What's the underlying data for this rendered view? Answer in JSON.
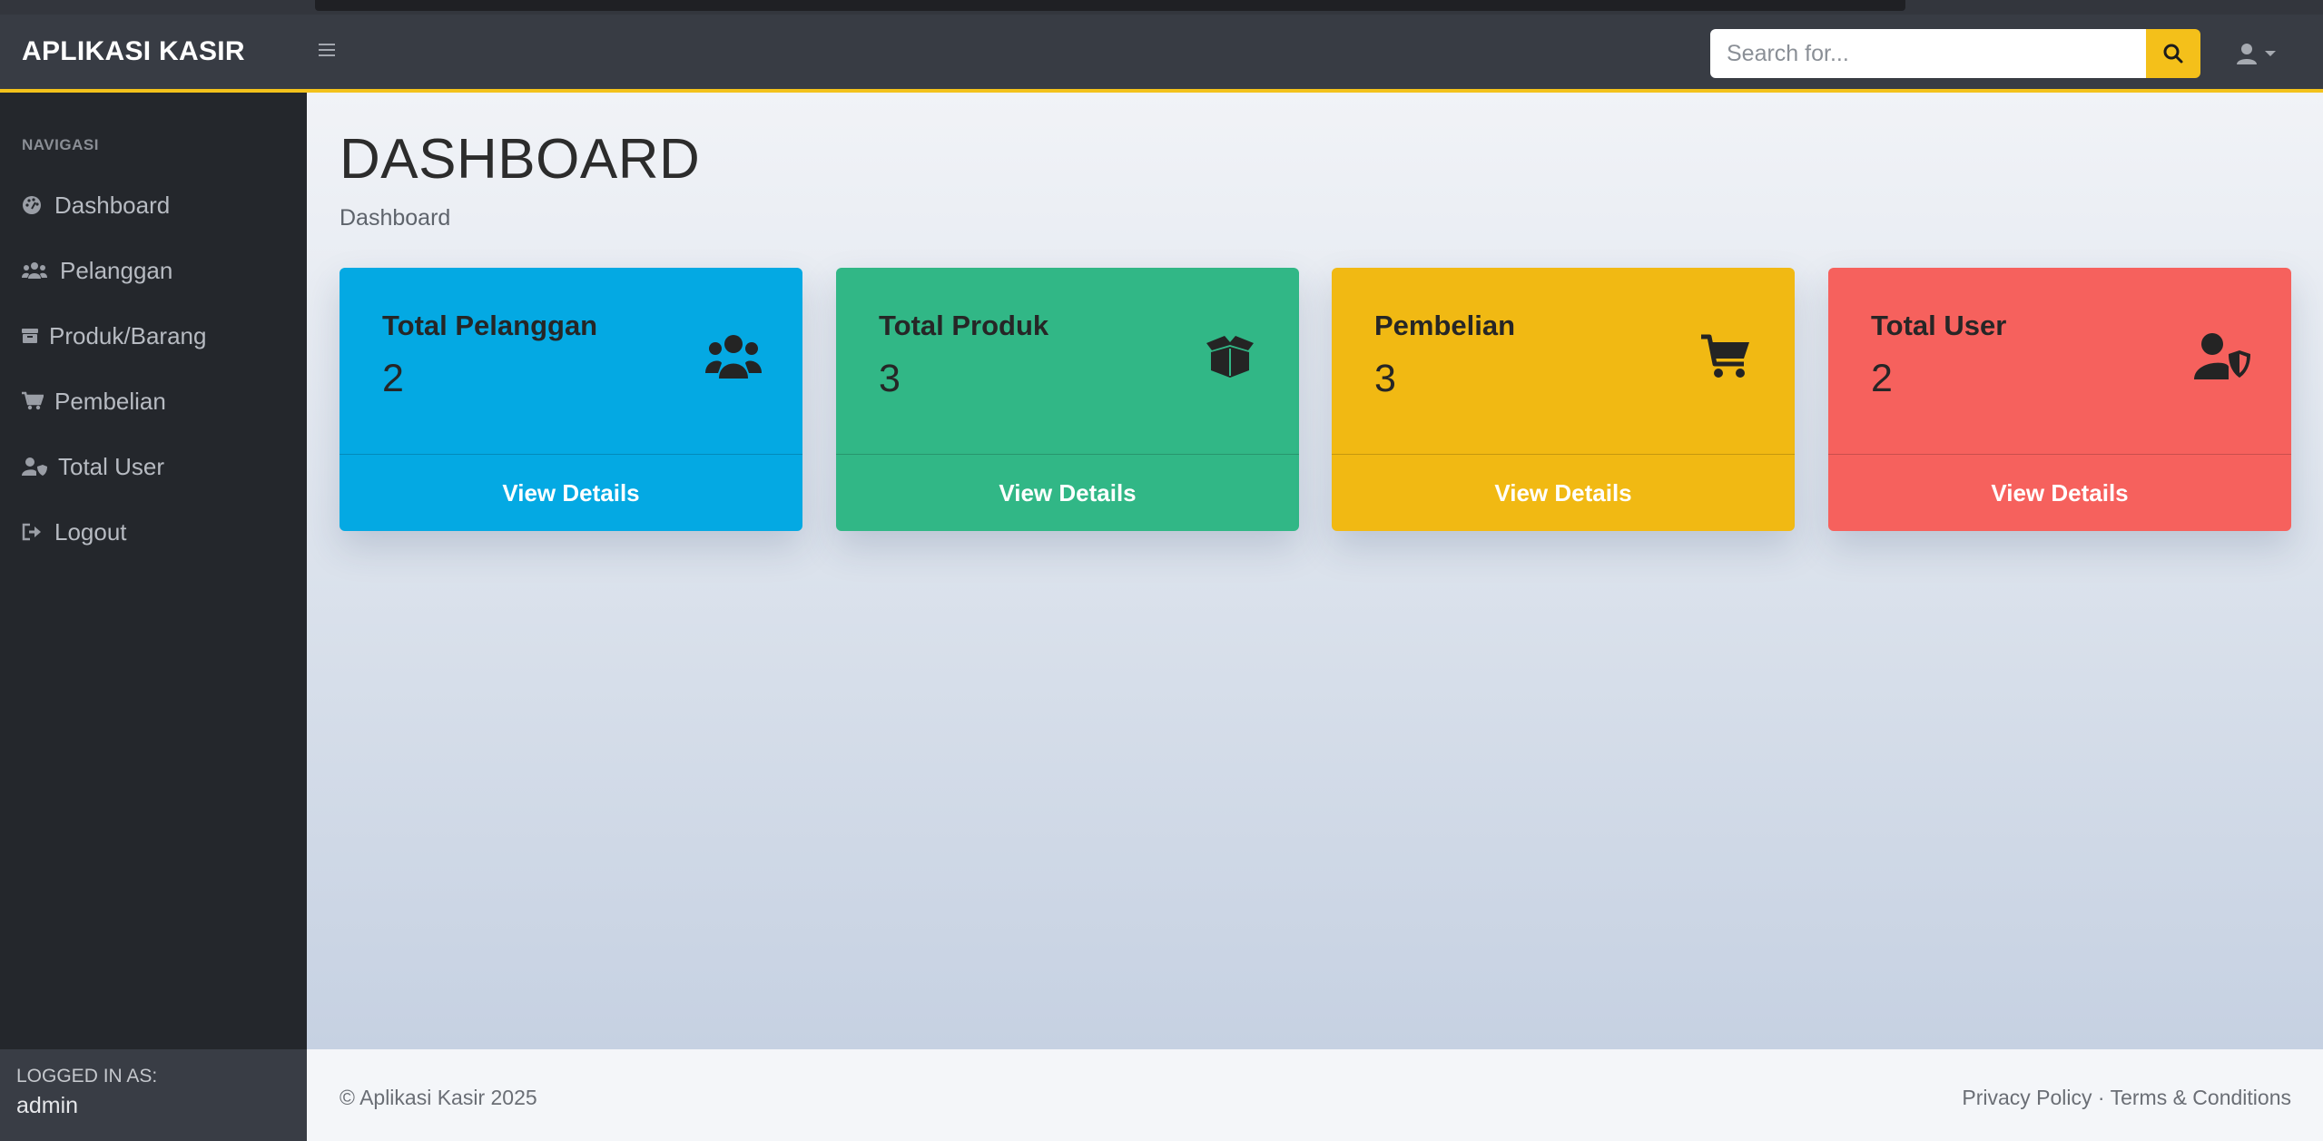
{
  "app": {
    "brand": "APLIKASI KASIR"
  },
  "search": {
    "placeholder": "Search for..."
  },
  "sidebar": {
    "heading": "NAVIGASI",
    "items": [
      {
        "label": "Dashboard",
        "icon": "dashboard-icon"
      },
      {
        "label": "Pelanggan",
        "icon": "users-icon"
      },
      {
        "label": "Produk/Barang",
        "icon": "box-icon"
      },
      {
        "label": "Pembelian",
        "icon": "cart-icon"
      },
      {
        "label": "Total User",
        "icon": "user-shield-icon"
      },
      {
        "label": "Logout",
        "icon": "logout-icon"
      }
    ],
    "footer": {
      "label": "LOGGED IN AS:",
      "user": "admin"
    }
  },
  "main": {
    "title": "DASHBOARD",
    "breadcrumb": "Dashboard",
    "cards": [
      {
        "title": "Total Pelanggan",
        "value": "2",
        "link": "View Details",
        "color": "#04a9e3",
        "icon": "users-icon"
      },
      {
        "title": "Total Produk",
        "value": "3",
        "link": "View Details",
        "color": "#31b786",
        "icon": "box-open-icon"
      },
      {
        "title": "Pembelian",
        "value": "3",
        "link": "View Details",
        "color": "#f1b913",
        "icon": "cart-icon"
      },
      {
        "title": "Total User",
        "value": "2",
        "link": "View Details",
        "color": "#f6615d",
        "icon": "user-shield-icon"
      }
    ]
  },
  "footer": {
    "copyright": "© Aplikasi Kasir 2025",
    "privacy": "Privacy Policy",
    "separator": "·",
    "terms": "Terms & Conditions"
  },
  "colors": {
    "accent": "#f3c21b",
    "navbar": "#383c44",
    "sidebar": "#24272c"
  }
}
